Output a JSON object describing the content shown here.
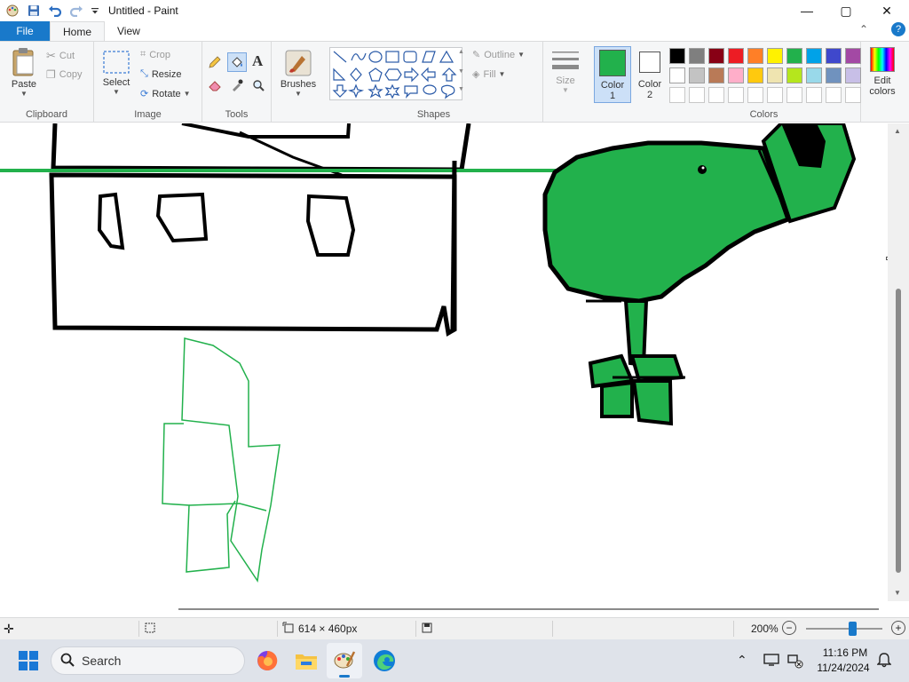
{
  "window": {
    "title": "Untitled - Paint",
    "controls": {
      "minimize": "—",
      "maximize": "▢",
      "close": "✕"
    }
  },
  "menu": {
    "tabs": [
      {
        "label": "File"
      },
      {
        "label": "Home"
      },
      {
        "label": "View"
      }
    ]
  },
  "ribbon": {
    "clipboard": {
      "label": "Clipboard",
      "paste": "Paste",
      "cut": "Cut",
      "copy": "Copy"
    },
    "image": {
      "label": "Image",
      "select": "Select",
      "crop": "Crop",
      "resize": "Resize",
      "rotate": "Rotate"
    },
    "tools": {
      "label": "Tools"
    },
    "brushes": {
      "label": "Brushes"
    },
    "shapes": {
      "label": "Shapes",
      "outline": "Outline",
      "fill": "Fill"
    },
    "size": {
      "label": "Size"
    },
    "color1": {
      "label1": "Color",
      "label2": "1",
      "value": "#22b14c"
    },
    "color2": {
      "label1": "Color",
      "label2": "2",
      "value": "#ffffff"
    },
    "colors": {
      "label": "Colors",
      "edit_label1": "Edit",
      "edit_label2": "colors",
      "row1": [
        "#000000",
        "#7f7f7f",
        "#880015",
        "#ed1c24",
        "#ff7f27",
        "#fff200",
        "#22b14c",
        "#00a2e8",
        "#3f48cc",
        "#a349a4"
      ],
      "row2": [
        "#ffffff",
        "#c3c3c3",
        "#b97a57",
        "#ffaec9",
        "#ffc90e",
        "#efe4b0",
        "#b5e61d",
        "#99d9ea",
        "#7092be",
        "#c8bfe7"
      ]
    }
  },
  "status": {
    "canvas_size": "614 × 460px",
    "zoom": "200%",
    "zoom_slider": 0.6
  },
  "taskbar": {
    "search_placeholder": "Search",
    "time": "11:16 PM",
    "date": "11/24/2024"
  }
}
